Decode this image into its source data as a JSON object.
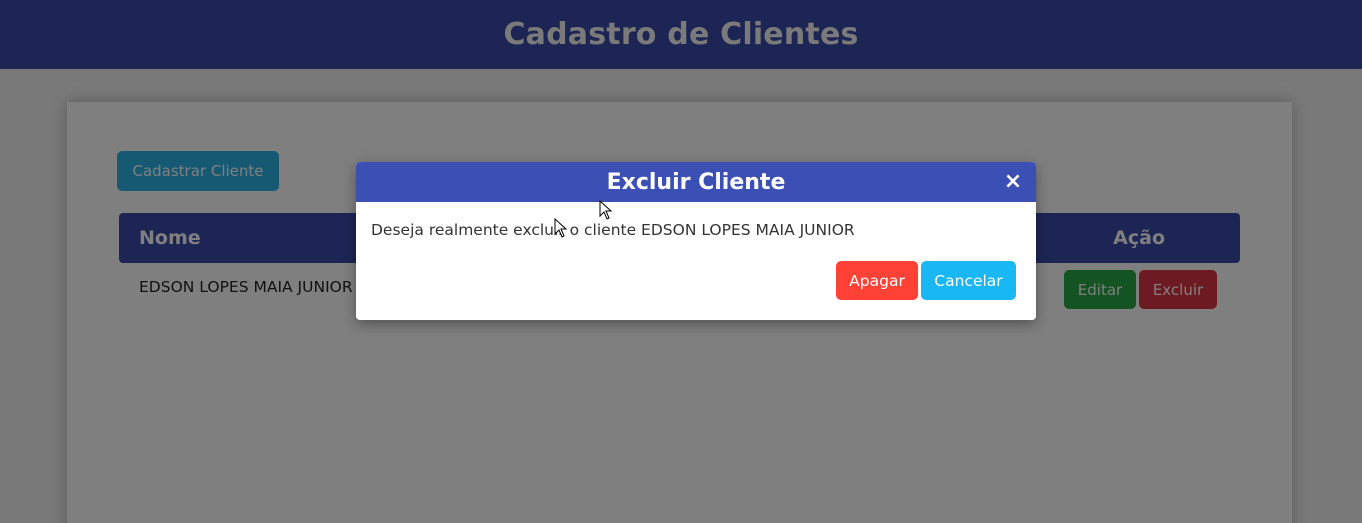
{
  "header": {
    "title": "Cadastro de Clientes"
  },
  "toolbar": {
    "register_label": "Cadastrar Cliente"
  },
  "table": {
    "columns": [
      "Nome",
      "Ação"
    ],
    "rows": [
      {
        "name": "EDSON LOPES MAIA JUNIOR",
        "edit_label": "Editar",
        "delete_label": "Excluir"
      }
    ]
  },
  "modal": {
    "title": "Excluir Cliente",
    "close_icon": "close-icon",
    "message": "Deseja realmente excluir o cliente EDSON LOPES MAIA JUNIOR",
    "confirm_label": "Apagar",
    "cancel_label": "Cancelar"
  },
  "colors": {
    "primary": "#3b4aa8",
    "info": "#1ab7f5",
    "success": "#28a745",
    "danger": "#ff4136"
  }
}
